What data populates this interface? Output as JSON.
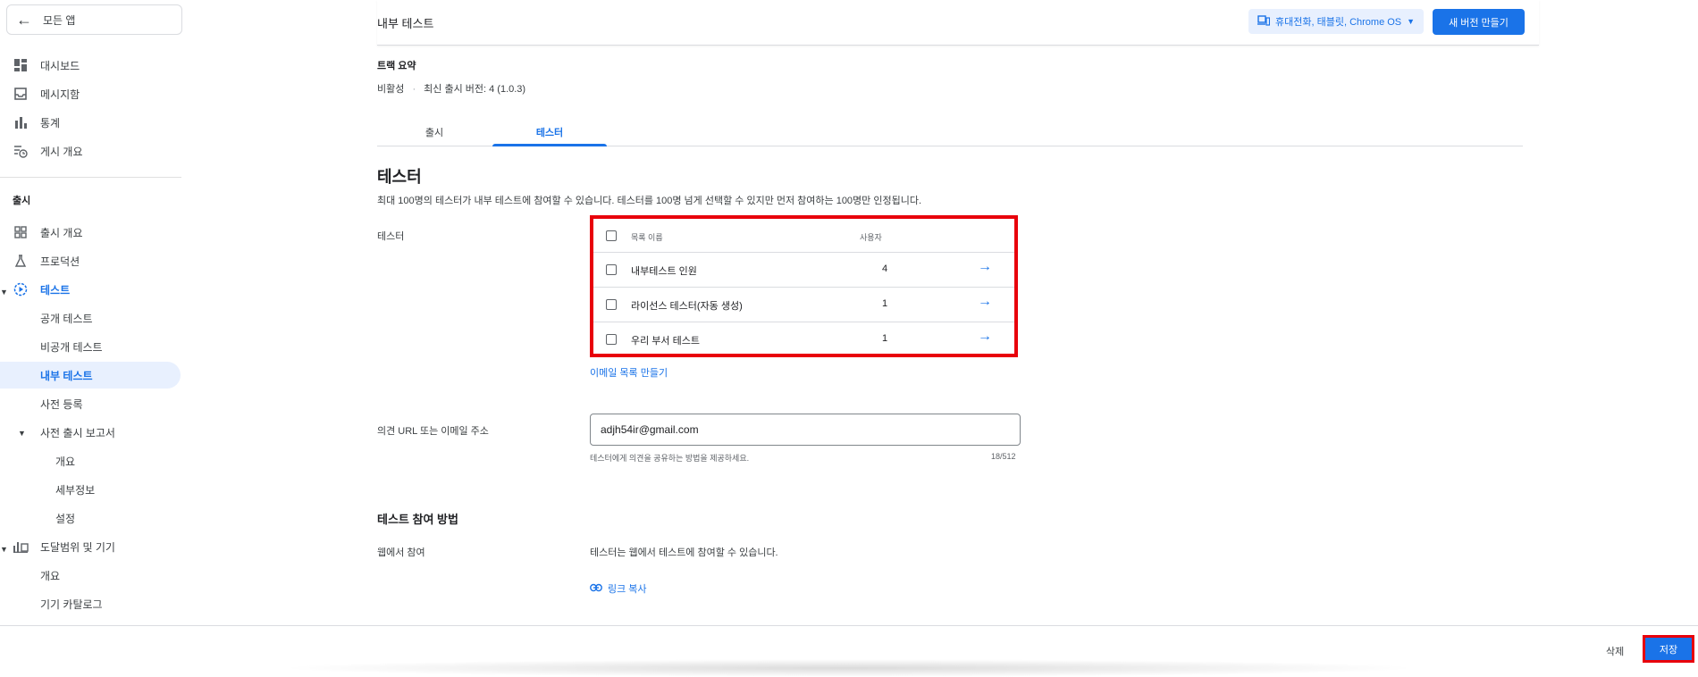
{
  "sidebar": {
    "all_apps": "모든 앱",
    "items": [
      {
        "label": "대시보드",
        "icon": "dashboard-icon"
      },
      {
        "label": "메시지함",
        "icon": "inbox-icon"
      },
      {
        "label": "통계",
        "icon": "bar-chart-icon"
      },
      {
        "label": "게시 개요",
        "icon": "publishing-overview-icon"
      }
    ],
    "release_section": "출시",
    "release_items": [
      {
        "label": "출시 개요",
        "icon": "release-overview-icon"
      },
      {
        "label": "프로덕션",
        "icon": "production-icon"
      },
      {
        "label": "테스트",
        "icon": "testing-icon"
      },
      {
        "label": "공개 테스트"
      },
      {
        "label": "비공개 테스트"
      },
      {
        "label": "내부 테스트"
      },
      {
        "label": "사전 등록"
      },
      {
        "label": "사전 출시 보고서"
      },
      {
        "label": "개요"
      },
      {
        "label": "세부정보"
      },
      {
        "label": "설정"
      },
      {
        "label": "도달범위 및 기기",
        "icon": "reach-devices-icon"
      },
      {
        "label": "개요"
      },
      {
        "label": "기기 카탈로그"
      }
    ]
  },
  "header": {
    "title": "내부 테스트",
    "device_button": "휴대전화, 태블릿, Chrome OS",
    "new_release": "새 버전 만들기"
  },
  "summary": {
    "title": "트랙 요약",
    "status": "비활성",
    "sep": "·",
    "latest": "최신 출시 버전: 4 (1.0.3)"
  },
  "tabs": [
    "출시",
    "테스터"
  ],
  "testers": {
    "heading": "테스터",
    "description": "최대 100명의 테스터가 내부 테스트에 참여할 수 있습니다. 테스터를 100명 넘게 선택할 수 있지만 먼저 참여하는 100명만 인정됩니다.",
    "label": "테스터",
    "columns": [
      "목록 이름",
      "사용자"
    ],
    "rows": [
      {
        "name": "내부테스트 인원",
        "users": "4"
      },
      {
        "name": "라이선스 테스터(자동 생성)",
        "users": "1"
      },
      {
        "name": "우리 부서 테스트",
        "users": "1"
      }
    ],
    "create_email_list": "이메일 목록 만들기"
  },
  "feedback": {
    "label": "의견 URL 또는 이메일 주소",
    "value": "adjh54ir@gmail.com",
    "helper": "테스터에게 의견을 공유하는 방법을 제공하세요.",
    "counter": "18/512"
  },
  "join": {
    "heading": "테스트 참여 방법",
    "label": "웹에서 참여",
    "text": "테스터는 웹에서 테스트에 참여할 수 있습니다.",
    "copy_link": "링크 복사"
  },
  "footer": {
    "delete": "삭제",
    "save": "저장"
  },
  "colors": {
    "accent": "#1a73e8",
    "highlight": "#e8000b"
  }
}
